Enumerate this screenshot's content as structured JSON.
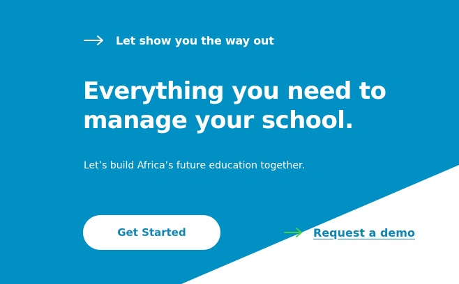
{
  "hero": {
    "eyebrow": {
      "icon": "arrow-right-icon",
      "text": "Let show you the way out"
    },
    "headline_line1": "Everything you need to",
    "headline_line2": "manage your school.",
    "subtext": "Let’s build Africa’s future education together.",
    "primary_cta": "Get Started",
    "secondary_cta": {
      "icon": "arrow-right-icon",
      "label": "Request a demo"
    }
  },
  "colors": {
    "background": "#0090c4",
    "diagonal": "#ffffff",
    "button_bg": "#ffffff",
    "button_text": "#0f86b4",
    "demo_arrow": "#45d145",
    "demo_link": "#0f86b4"
  }
}
